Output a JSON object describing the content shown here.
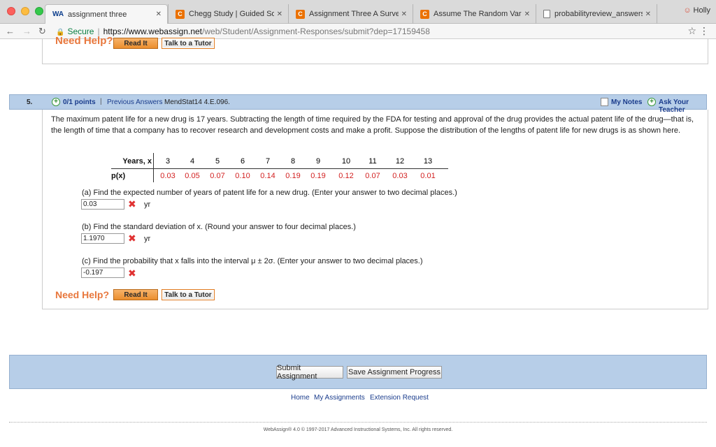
{
  "browser": {
    "tabs": [
      {
        "title": "assignment three",
        "favicon": "webassign-logo"
      },
      {
        "title": "Chegg Study | Guided Soluti",
        "favicon": "chegg-icon"
      },
      {
        "title": "Assignment Three A Survey C",
        "favicon": "chegg-icon"
      },
      {
        "title": "Assume The Random Variabl",
        "favicon": "chegg-icon"
      },
      {
        "title": "probabilityreview_answers.pc",
        "favicon": "document-icon"
      }
    ],
    "profile_name": "Holly",
    "address": {
      "secure_label": "Secure",
      "host": "https://www.webassign.net",
      "path": "/web/Student/Assignment-Responses/submit?dep=17159458"
    }
  },
  "previous_question": {
    "need_help": "Need Help?",
    "read_it": "Read It",
    "talk_to_tutor": "Talk to a Tutor"
  },
  "question": {
    "number": "5.",
    "points": "0/1 points",
    "previous_answers": "Previous Answers",
    "source": "MendStat14 4.E.096.",
    "my_notes": "My Notes",
    "ask_teacher": "Ask Your Teacher",
    "prompt": "The maximum patent life for a new drug is 17 years. Subtracting the length of time required by the FDA for testing and approval of the drug provides the actual patent life of the drug—that is, the length of time that a company has to recover research and development costs and make a profit. Suppose the distribution of the lengths of patent life for new drugs is as shown here.",
    "table": {
      "x_header": "Years, x",
      "p_header": "p(x)",
      "x_values": [
        "3",
        "4",
        "5",
        "6",
        "7",
        "8",
        "9",
        "10",
        "11",
        "12",
        "13"
      ],
      "p_values": [
        "0.03",
        "0.05",
        "0.07",
        "0.10",
        "0.14",
        "0.19",
        "0.19",
        "0.12",
        "0.07",
        "0.03",
        "0.01"
      ]
    },
    "parts": [
      {
        "label": "(a) Find the expected number of years of patent life for a new drug. (Enter your answer to two decimal places.)",
        "answer": "0.03",
        "unit": "yr",
        "status": "incorrect"
      },
      {
        "label": "(b) Find the standard deviation of x. (Round your answer to four decimal places.)",
        "answer": "1.1970",
        "unit": "yr",
        "status": "incorrect"
      },
      {
        "label": "(c) Find the probability that x falls into the interval μ ± 2σ. (Enter your answer to two decimal places.)",
        "answer": "-0.197",
        "unit": "",
        "status": "incorrect"
      }
    ],
    "need_help": "Need Help?",
    "read_it": "Read It",
    "talk_to_tutor": "Talk to a Tutor"
  },
  "submit": {
    "submit_assignment": "Submit Assignment",
    "save_progress": "Save Assignment Progress"
  },
  "footer": {
    "home": "Home",
    "my_assignments": "My Assignments",
    "extension_request": "Extension Request",
    "copyright": "WebAssign® 4.0 © 1997-2017 Advanced Instructional Systems, Inc. All rights reserved."
  },
  "colors": {
    "header_blue": "#b7cee8",
    "link_blue": "#1a3c8c",
    "help_orange": "#e8773c",
    "incorrect_red": "#e03131",
    "probability_red": "#d21f1f"
  }
}
